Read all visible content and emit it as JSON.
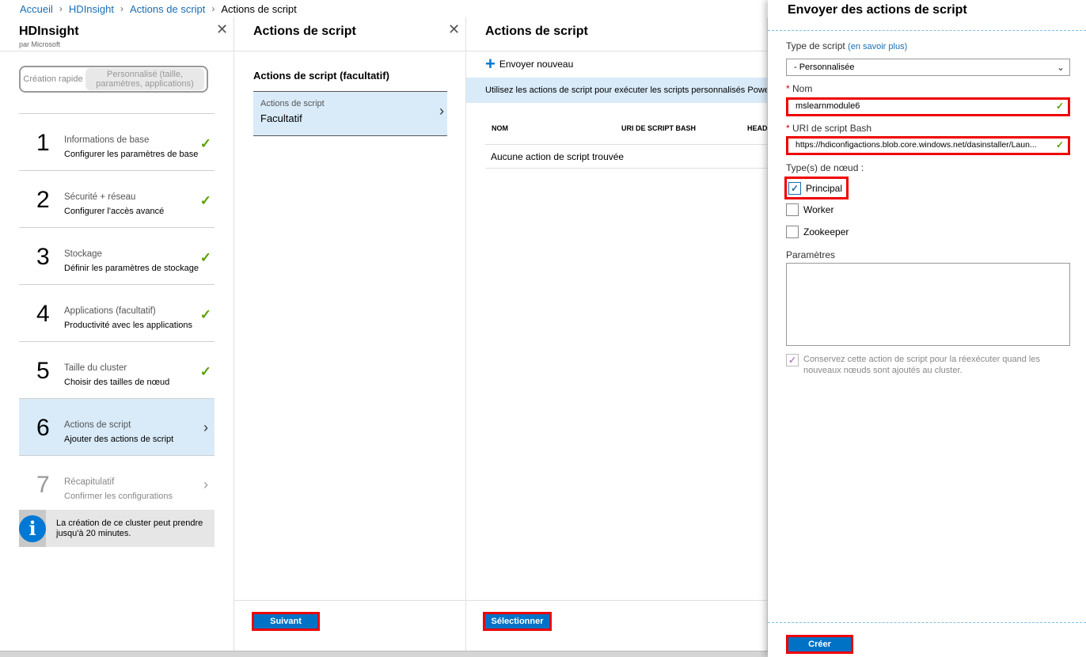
{
  "breadcrumb": {
    "items": [
      "Accueil",
      "HDInsight",
      "Actions de script"
    ],
    "current": "Actions de script",
    "separator": "›"
  },
  "hdinsight_blade": {
    "title": "HDInsight",
    "subtitle": "par Microsoft",
    "mode_toggle": {
      "quick": "Création rapide",
      "custom": "Personnalisé (taille, paramètres, applications)"
    },
    "steps": [
      {
        "num": "1",
        "title": "Informations de base",
        "subtitle": "Configurer les paramètres de base",
        "status": "done"
      },
      {
        "num": "2",
        "title": "Sécurité + réseau",
        "subtitle": "Configurer l'accès avancé",
        "status": "done"
      },
      {
        "num": "3",
        "title": "Stockage",
        "subtitle": "Définir les paramètres de stockage",
        "status": "done"
      },
      {
        "num": "4",
        "title": "Applications (facultatif)",
        "subtitle": "Productivité avec les applications",
        "status": "done"
      },
      {
        "num": "5",
        "title": "Taille du cluster",
        "subtitle": "Choisir des tailles de nœud",
        "status": "done"
      },
      {
        "num": "6",
        "title": "Actions de script",
        "subtitle": "Ajouter des actions de script",
        "status": "active"
      },
      {
        "num": "7",
        "title": "Récapitulatif",
        "subtitle": "Confirmer les configurations",
        "status": "disabled"
      }
    ],
    "info": "La création de ce cluster peut prendre jusqu'à 20 minutes."
  },
  "script_actions_blade": {
    "title": "Actions de script",
    "section_heading": "Actions de script (facultatif)",
    "item": {
      "label": "Actions de script",
      "value": "Facultatif"
    },
    "next_button": "Suivant"
  },
  "script_list_blade": {
    "title": "Actions de script",
    "add_new": "Envoyer nouveau",
    "info_strip": "Utilisez les actions de script pour exécuter les scripts personnalisés PowerS",
    "columns": [
      "NOM",
      "URI DE SCRIPT BASH",
      "HEAD"
    ],
    "empty_message": "Aucune action de script trouvée",
    "select_button": "Sélectionner"
  },
  "submit_panel": {
    "title": "Envoyer des actions de script",
    "script_type_label": "Type de script",
    "learn_more": "(en savoir plus)",
    "script_type_value": "- Personnalisée",
    "required_mark": "*",
    "name_label": "Nom",
    "name_value": "mslearnmodule6",
    "uri_label": "URI de script Bash",
    "uri_value": "https://hdiconfigactions.blob.core.windows.net/dasinstaller/Laun...",
    "node_types_label": "Type(s) de nœud :",
    "node_types": [
      {
        "label": "Principal",
        "checked": true
      },
      {
        "label": "Worker",
        "checked": false
      },
      {
        "label": "Zookeeper",
        "checked": false
      }
    ],
    "params_label": "Paramètres",
    "params_value": "",
    "persist_label": "Conservez cette action de script pour la réexécuter quand les nouveaux nœuds sont ajoutés au cluster.",
    "persist_checked": true,
    "create_button": "Créer"
  },
  "icons": {
    "close": "close-icon",
    "check": "checkmark-icon",
    "chevron": "chevron-right-icon",
    "info": "info-icon",
    "plus": "plus-icon"
  },
  "colors": {
    "accent": "#0072c6",
    "active_bg": "#d9ebf9",
    "success": "#57a300",
    "highlight_border": "#e00000"
  }
}
